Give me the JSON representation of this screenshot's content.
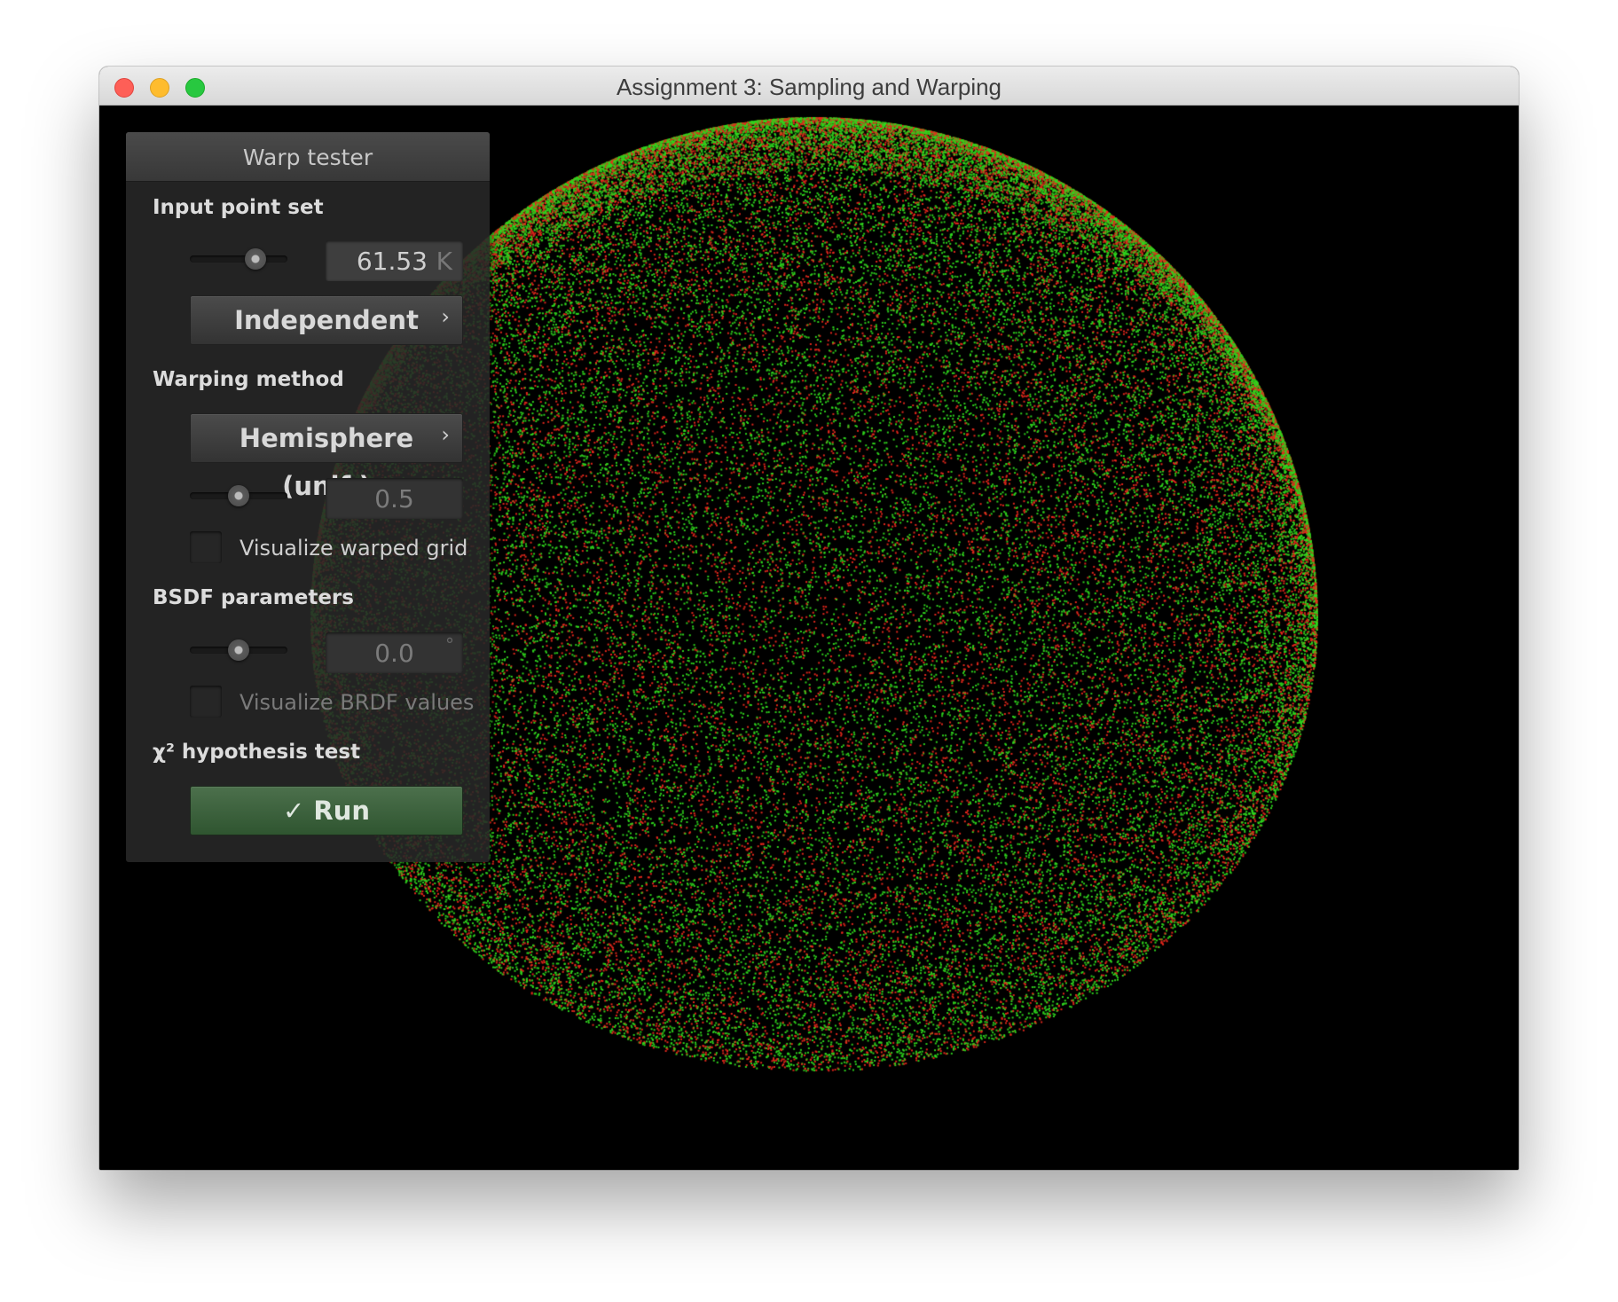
{
  "window": {
    "title": "Assignment 3: Sampling and Warping"
  },
  "panel": {
    "title": "Warp tester",
    "input_point_set": {
      "label": "Input point set",
      "slider_level": 0.72,
      "value": "61.53",
      "unit": "K",
      "sampler": "Independent"
    },
    "warping_method": {
      "label": "Warping method",
      "method": "Hemisphere (unif.)",
      "slider_level": 0.5,
      "param_value": "0.5",
      "visualize_grid_label": "Visualize warped grid",
      "visualize_grid_checked": false
    },
    "bsdf": {
      "label": "BSDF parameters",
      "slider_level": 0.5,
      "value": "0.0",
      "unit": "°",
      "visualize_brdf_label": "Visualize BRDF values",
      "visualize_brdf_checked": false
    },
    "hypothesis": {
      "label": "χ² hypothesis test",
      "run_label": "✓ Run"
    }
  },
  "visualization": {
    "point_colors": [
      "#2fd61e",
      "#e8281c"
    ],
    "shape": "hemisphere",
    "background": "#000000"
  },
  "colors": {
    "run_button": "#3f6440",
    "close": "#fe5f57",
    "minimize": "#febc2e",
    "maximize": "#28c840"
  }
}
